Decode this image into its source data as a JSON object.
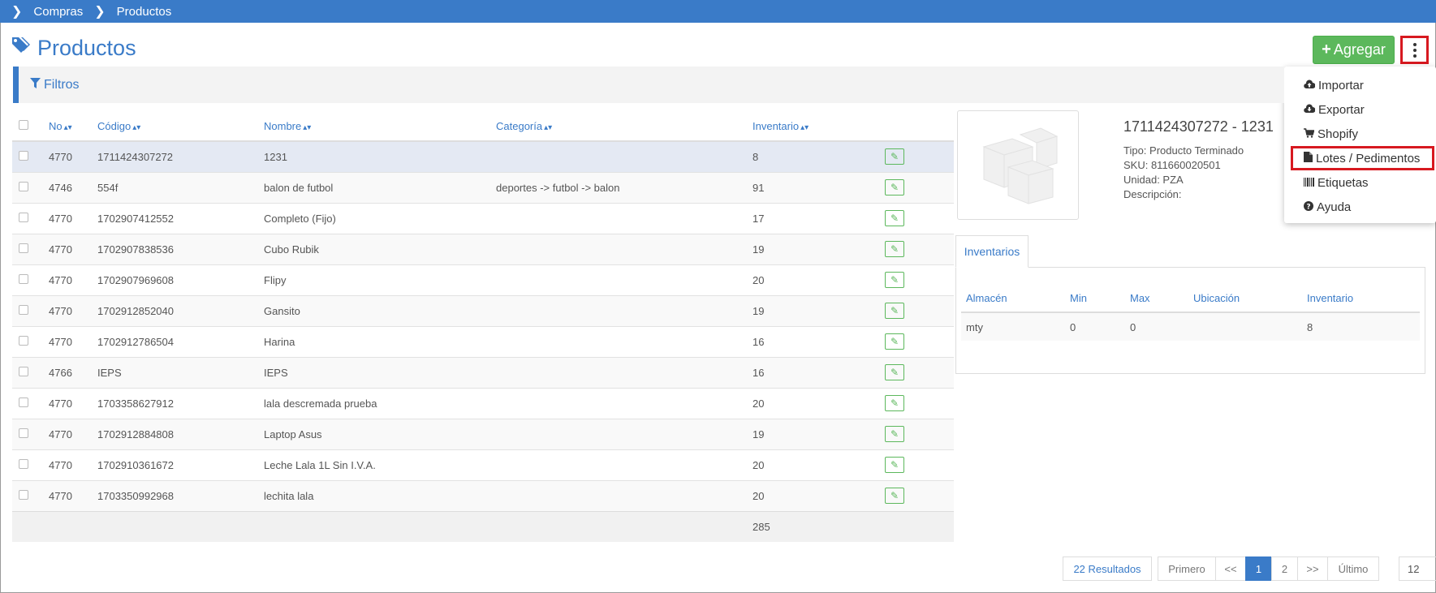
{
  "breadcrumb": {
    "items": [
      "Compras",
      "Productos"
    ]
  },
  "page": {
    "title": "Productos"
  },
  "toolbar": {
    "add_label": "Agregar"
  },
  "menu": {
    "items": [
      {
        "label": "Importar",
        "icon": "cloud-upload-icon"
      },
      {
        "label": "Exportar",
        "icon": "cloud-download-icon"
      },
      {
        "label": "Shopify",
        "icon": "cart-icon"
      },
      {
        "label": "Lotes / Pedimentos",
        "icon": "file-icon"
      },
      {
        "label": "Etiquetas",
        "icon": "barcode-icon"
      },
      {
        "label": "Ayuda",
        "icon": "question-icon"
      }
    ],
    "highlight_color": "#d71920"
  },
  "filters": {
    "label": "Filtros"
  },
  "table": {
    "columns": [
      "No",
      "Código",
      "Nombre",
      "Categoría",
      "Inventario"
    ],
    "rows": [
      {
        "no": "4770",
        "codigo": "1711424307272",
        "nombre": "1231",
        "categoria": "",
        "inventario": "8"
      },
      {
        "no": "4746",
        "codigo": "554f",
        "nombre": "balon de futbol",
        "categoria": "deportes -> futbol -> balon",
        "inventario": "91"
      },
      {
        "no": "4770",
        "codigo": "1702907412552",
        "nombre": "Completo (Fijo)",
        "categoria": "",
        "inventario": "17"
      },
      {
        "no": "4770",
        "codigo": "1702907838536",
        "nombre": "Cubo Rubik",
        "categoria": "",
        "inventario": "19"
      },
      {
        "no": "4770",
        "codigo": "1702907969608",
        "nombre": "Flipy",
        "categoria": "",
        "inventario": "20"
      },
      {
        "no": "4770",
        "codigo": "1702912852040",
        "nombre": "Gansito",
        "categoria": "",
        "inventario": "19"
      },
      {
        "no": "4770",
        "codigo": "1702912786504",
        "nombre": "Harina",
        "categoria": "",
        "inventario": "16"
      },
      {
        "no": "4766",
        "codigo": "IEPS",
        "nombre": "IEPS",
        "categoria": "",
        "inventario": "16"
      },
      {
        "no": "4770",
        "codigo": "1703358627912",
        "nombre": "lala descremada prueba",
        "categoria": "",
        "inventario": "20"
      },
      {
        "no": "4770",
        "codigo": "1702912884808",
        "nombre": "Laptop Asus",
        "categoria": "",
        "inventario": "19"
      },
      {
        "no": "4770",
        "codigo": "1702910361672",
        "nombre": "Leche Lala 1L Sin I.V.A.",
        "categoria": "",
        "inventario": "20"
      },
      {
        "no": "4770",
        "codigo": "1703350992968",
        "nombre": "lechita lala",
        "categoria": "",
        "inventario": "20"
      }
    ],
    "total": "285"
  },
  "detail": {
    "title": "1711424307272 - 1231",
    "tipo": "Tipo: Producto Terminado",
    "sku": "SKU: 811660020501",
    "unidad": "Unidad: PZA",
    "descripcion": "Descripción:",
    "tab": "Inventarios",
    "inv_columns": [
      "Almacén",
      "Min",
      "Max",
      "Ubicación",
      "Inventario"
    ],
    "inv_rows": [
      {
        "almacen": "mty",
        "min": "0",
        "max": "0",
        "ubicacion": "",
        "inventario": "8"
      }
    ]
  },
  "pagination": {
    "results": "22 Resultados",
    "first": "Primero",
    "prev": "<<",
    "pages": [
      "1",
      "2"
    ],
    "next": ">>",
    "last": "Último",
    "per_page": "12"
  },
  "colors": {
    "primary": "#3a7bc8",
    "success": "#5cb85c",
    "highlight": "#d71920"
  }
}
